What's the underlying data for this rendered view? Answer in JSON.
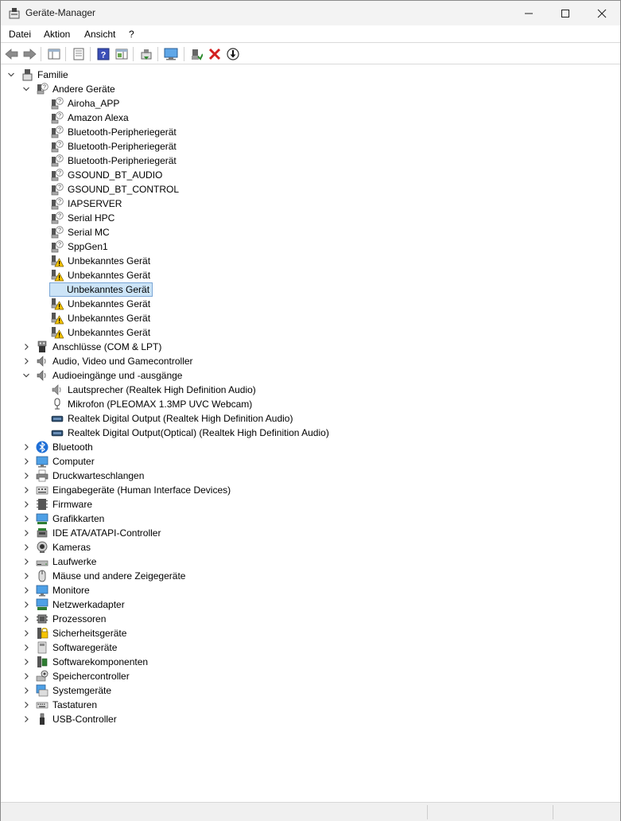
{
  "window": {
    "title": "Geräte-Manager"
  },
  "menu": {
    "file": "Datei",
    "action": "Aktion",
    "view": "Ansicht",
    "help": "?"
  },
  "tree": {
    "root": "Familie",
    "andere_geraete": {
      "label": "Andere Geräte",
      "items": [
        {
          "label": "Airoha_APP",
          "icon": "unknown-device-icon"
        },
        {
          "label": "Amazon Alexa",
          "icon": "unknown-device-icon"
        },
        {
          "label": "Bluetooth-Peripheriegerät",
          "icon": "unknown-device-icon"
        },
        {
          "label": "Bluetooth-Peripheriegerät",
          "icon": "unknown-device-icon"
        },
        {
          "label": "Bluetooth-Peripheriegerät",
          "icon": "unknown-device-icon"
        },
        {
          "label": "GSOUND_BT_AUDIO",
          "icon": "unknown-device-icon"
        },
        {
          "label": "GSOUND_BT_CONTROL",
          "icon": "unknown-device-icon"
        },
        {
          "label": "IAPSERVER",
          "icon": "unknown-device-icon"
        },
        {
          "label": "Serial HPC",
          "icon": "unknown-device-icon"
        },
        {
          "label": "Serial MC",
          "icon": "unknown-device-icon"
        },
        {
          "label": "SppGen1",
          "icon": "unknown-device-icon"
        },
        {
          "label": "Unbekanntes Gerät",
          "icon": "warning-device-icon"
        },
        {
          "label": "Unbekanntes Gerät",
          "icon": "warning-device-icon"
        },
        {
          "label": "Unbekanntes Gerät",
          "icon": "warning-device-icon"
        },
        {
          "label": "Unbekanntes Gerät",
          "icon": "warning-device-icon"
        },
        {
          "label": "Unbekanntes Gerät",
          "icon": "warning-device-icon"
        },
        {
          "label": "Unbekanntes Gerät",
          "icon": "warning-device-icon"
        }
      ]
    },
    "anschluesse": "Anschlüsse (COM & LPT)",
    "audio_video": "Audio, Video und Gamecontroller",
    "audio_io": {
      "label": "Audioeingänge und -ausgänge",
      "items": [
        {
          "label": "Lautsprecher (Realtek High Definition Audio)",
          "icon": "speaker-icon"
        },
        {
          "label": "Mikrofon (PLEOMAX 1.3MP UVC Webcam)",
          "icon": "microphone-icon"
        },
        {
          "label": "Realtek Digital Output (Realtek High Definition Audio)",
          "icon": "digital-output-icon"
        },
        {
          "label": "Realtek Digital Output(Optical) (Realtek High Definition Audio)",
          "icon": "digital-output-icon"
        }
      ]
    },
    "categories": [
      {
        "label": "Bluetooth",
        "icon": "bluetooth-icon"
      },
      {
        "label": "Computer",
        "icon": "computer-icon"
      },
      {
        "label": "Druckwarteschlangen",
        "icon": "printer-icon"
      },
      {
        "label": "Eingabegeräte (Human Interface Devices)",
        "icon": "hid-icon"
      },
      {
        "label": "Firmware",
        "icon": "firmware-icon"
      },
      {
        "label": "Grafikkarten",
        "icon": "display-adapter-icon"
      },
      {
        "label": "IDE ATA/ATAPI-Controller",
        "icon": "ide-controller-icon"
      },
      {
        "label": "Kameras",
        "icon": "camera-icon"
      },
      {
        "label": "Laufwerke",
        "icon": "drive-icon"
      },
      {
        "label": "Mäuse und andere Zeigegeräte",
        "icon": "mouse-icon"
      },
      {
        "label": "Monitore",
        "icon": "monitor-icon"
      },
      {
        "label": "Netzwerkadapter",
        "icon": "network-adapter-icon"
      },
      {
        "label": "Prozessoren",
        "icon": "processor-icon"
      },
      {
        "label": "Sicherheitsgeräte",
        "icon": "security-device-icon"
      },
      {
        "label": "Softwaregeräte",
        "icon": "software-device-icon"
      },
      {
        "label": "Softwarekomponenten",
        "icon": "software-component-icon"
      },
      {
        "label": "Speichercontroller",
        "icon": "storage-controller-icon"
      },
      {
        "label": "Systemgeräte",
        "icon": "system-device-icon"
      },
      {
        "label": "Tastaturen",
        "icon": "keyboard-icon"
      },
      {
        "label": "USB-Controller",
        "icon": "usb-controller-icon"
      }
    ]
  }
}
